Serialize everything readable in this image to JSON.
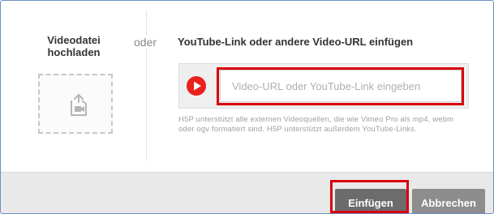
{
  "upload": {
    "title_line1": "Videodatei",
    "title_line2": "hochladen",
    "icon": "upload-video-icon"
  },
  "separator": {
    "label": "oder"
  },
  "url_section": {
    "title": "YouTube-Link oder andere Video-URL einfügen",
    "input_placeholder": "Video-URL oder YouTube-Link eingeben",
    "input_value": "",
    "play_icon": "youtube-play-icon",
    "help_text": "H5P unterstützt alle externen Videoquellen, die wie Vimeo Pro als mp4, webm oder ogv formatiert sind. H5P unterstützt außerdem YouTube-Links."
  },
  "footer": {
    "insert_label": "Einfügen",
    "cancel_label": "Abbrechen"
  },
  "colors": {
    "highlight": "#d8000c",
    "play": "#e8211c",
    "insert_button": "#6c6c6c",
    "cancel_button": "#8d8d8d",
    "footer_bg": "#e9e9e9"
  }
}
